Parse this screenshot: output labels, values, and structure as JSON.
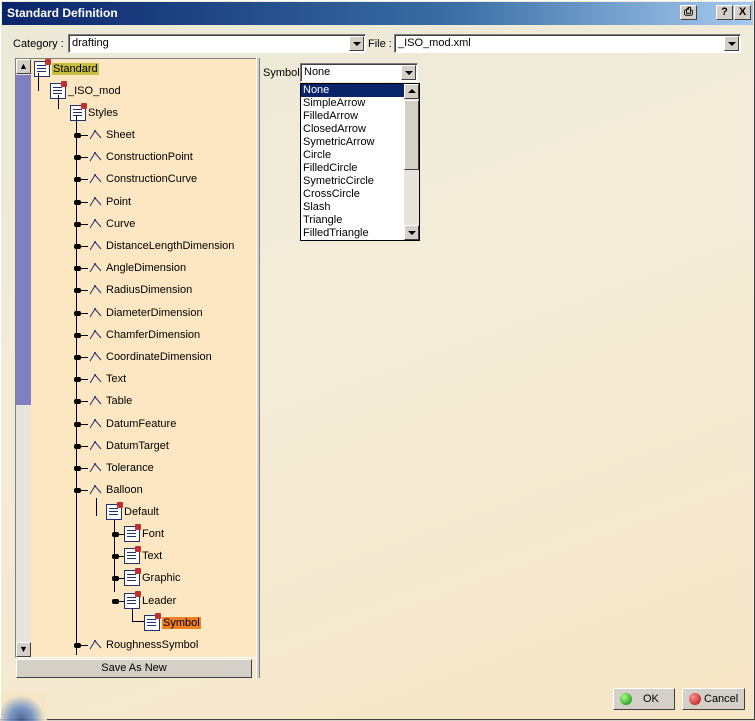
{
  "window": {
    "title": "Standard Definition"
  },
  "titlebar_buttons": {
    "print": "⎙",
    "help": "?",
    "close": "X"
  },
  "category": {
    "label": "Category :",
    "value": "drafting"
  },
  "file": {
    "label": "File :",
    "value": "_ISO_mod.xml"
  },
  "tree": {
    "root": "Standard",
    "iso_mod": "_ISO_mod",
    "styles": "Styles",
    "items": [
      "Sheet",
      "ConstructionPoint",
      "ConstructionCurve",
      "Point",
      "Curve",
      "DistanceLengthDimension",
      "AngleDimension",
      "RadiusDimension",
      "DiameterDimension",
      "ChamferDimension",
      "CoordinateDimension",
      "Text",
      "Table",
      "DatumFeature",
      "DatumTarget",
      "Tolerance",
      "Balloon"
    ],
    "default": "Default",
    "default_children": [
      "Font",
      "Text",
      "Graphic",
      "Leader"
    ],
    "symbol": "Symbol",
    "last": "RoughnessSymbol"
  },
  "save_as_new": "Save As New",
  "symbol": {
    "label": "Symbol",
    "value": "None",
    "options": [
      "None",
      "SimpleArrow",
      "FilledArrow",
      "ClosedArrow",
      "SymetricArrow",
      "Circle",
      "FilledCircle",
      "SymetricCircle",
      "CrossCircle",
      "Slash",
      "Triangle",
      "FilledTriangle"
    ]
  },
  "buttons": {
    "ok": "OK",
    "cancel": "Cancel"
  },
  "colors": {
    "tree_bg": "#fde7c3",
    "selected_bg": "#0a246a",
    "highlight_root": "#c8c040",
    "highlight_symbol": "#f08020"
  }
}
